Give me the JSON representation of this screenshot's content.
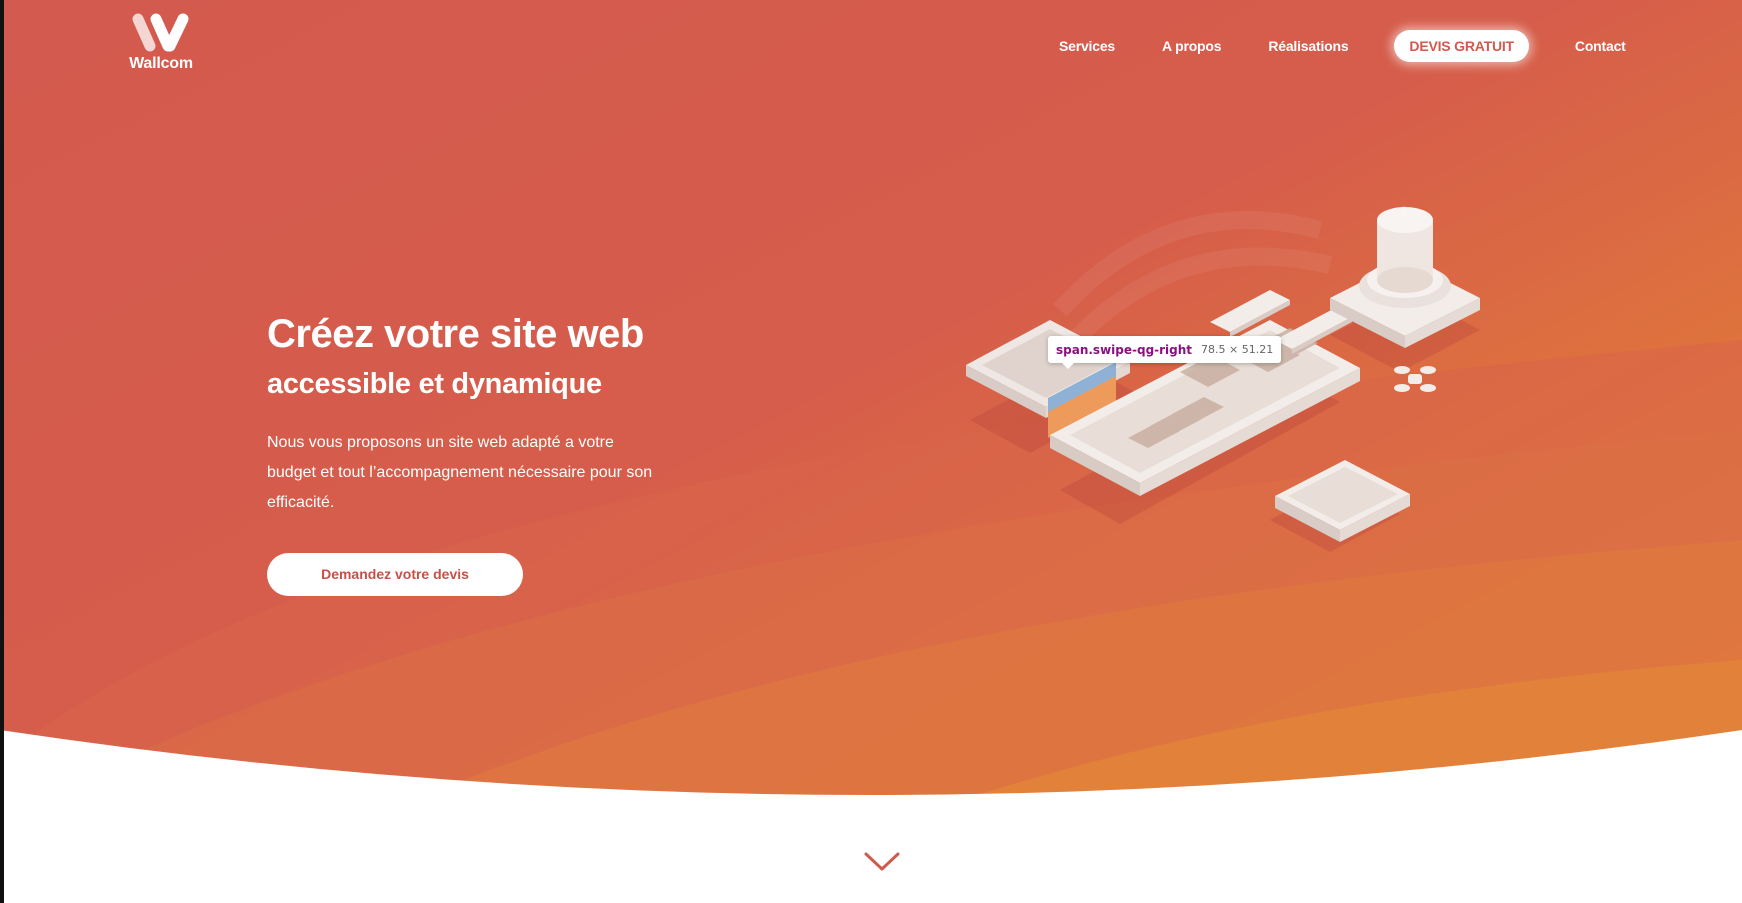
{
  "brand": {
    "name": "Wallcom"
  },
  "nav": {
    "items": [
      "Services",
      "A propos",
      "Réalisations"
    ],
    "cta": "DEVIS GRATUIT",
    "contact": "Contact"
  },
  "hero": {
    "title": "Créez votre site web",
    "subtitle": "accessible et dynamique",
    "description": "Nous vous proposons un site web adapté a votre budget et tout l’accompagnement nécessaire pour son efficacité.",
    "cta": "Demandez votre devis"
  },
  "devtools_tooltip": {
    "selector": "span.swipe-qg-right",
    "dimensions": "78.5 × 51.21"
  },
  "colors": {
    "hero_top": "#d35a4f",
    "hero_bottom": "#e6892d",
    "accent_text": "#c9504a",
    "white": "#ffffff"
  },
  "icons": {
    "logo": "w-logo-icon",
    "scroll": "chevron-down-icon"
  }
}
